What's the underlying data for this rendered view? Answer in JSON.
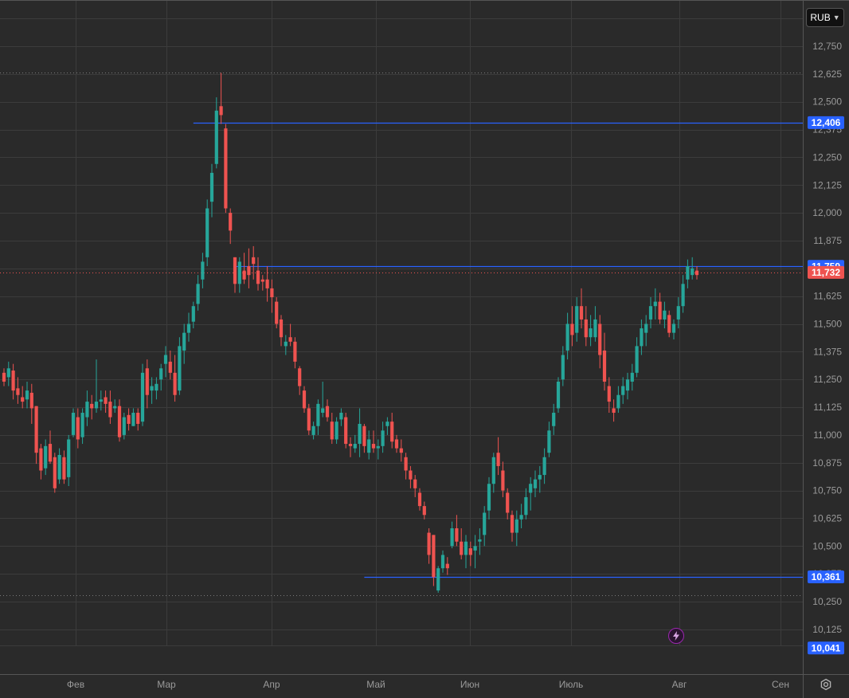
{
  "currency_selector": {
    "label": "RUB",
    "icon": "chevron-down-icon"
  },
  "settings": {
    "icon": "gear-icon"
  },
  "event_marker": {
    "icon": "lightning-icon",
    "color": "#9c27b0"
  },
  "colors": {
    "background": "#2a2a2a",
    "grid": "#3c3c3c",
    "up": "#26a69a",
    "down": "#ef5350",
    "level_line": "#2962ff",
    "level_tag": "#2962ff",
    "last_price_tag": "#ef5350"
  },
  "chart_data": {
    "type": "candlestick",
    "title": "",
    "currency": "RUB",
    "y_axis": {
      "range": [
        10.03,
        12.84
      ],
      "ticks": [
        "12,750",
        "12,625",
        "12,500",
        "12,375",
        "12,250",
        "12,125",
        "12,000",
        "11,875",
        "11,750",
        "11,625",
        "11,500",
        "11,375",
        "11,250",
        "11,125",
        "11,000",
        "10,875",
        "10,750",
        "10,625",
        "10,500",
        "10,375",
        "10,250",
        "10,125"
      ],
      "tick_values": [
        12.75,
        12.625,
        12.5,
        12.375,
        12.25,
        12.125,
        12.0,
        11.875,
        11.75,
        11.625,
        11.5,
        11.375,
        11.25,
        11.125,
        11.0,
        10.875,
        10.75,
        10.625,
        10.5,
        10.375,
        10.25,
        10.125
      ]
    },
    "x_axis": {
      "labels": [
        "Фев",
        "Мар",
        "Апр",
        "Май",
        "Июн",
        "Июль",
        "Авг",
        "Сен"
      ]
    },
    "price_tags": [
      {
        "label": "12,406",
        "value": 12.406,
        "kind": "level",
        "line_from_candle": 41
      },
      {
        "label": "11,759",
        "value": 11.759,
        "kind": "level",
        "line_from_candle": 50
      },
      {
        "label": "11,732",
        "value": 11.732,
        "kind": "last"
      },
      {
        "label": "10,361",
        "value": 10.361,
        "kind": "level",
        "line_from_candle": 78
      },
      {
        "label": "10,041",
        "value": 10.041,
        "kind": "level_tag_only"
      }
    ],
    "dotted_lines": [
      12.63,
      11.732,
      10.28
    ],
    "candles": [
      [
        11.28,
        11.3,
        11.22,
        11.24
      ],
      [
        11.26,
        11.33,
        11.22,
        11.3
      ],
      [
        11.29,
        11.32,
        11.16,
        11.2
      ],
      [
        11.21,
        11.26,
        11.14,
        11.18
      ],
      [
        11.17,
        11.22,
        11.12,
        11.15
      ],
      [
        11.16,
        11.24,
        11.12,
        11.2
      ],
      [
        11.19,
        11.23,
        11.05,
        11.12
      ],
      [
        11.13,
        11.13,
        10.87,
        10.92
      ],
      [
        10.94,
        10.96,
        10.8,
        10.84
      ],
      [
        10.85,
        10.98,
        10.82,
        10.95
      ],
      [
        10.96,
        11.02,
        10.87,
        10.88
      ],
      [
        10.9,
        10.92,
        10.74,
        10.76
      ],
      [
        10.8,
        10.94,
        10.78,
        10.91
      ],
      [
        10.9,
        10.93,
        10.78,
        10.8
      ],
      [
        10.81,
        11.0,
        10.77,
        10.98
      ],
      [
        11.0,
        11.12,
        10.99,
        11.1
      ],
      [
        11.08,
        11.12,
        10.94,
        10.98
      ],
      [
        10.99,
        11.12,
        10.96,
        11.1
      ],
      [
        11.08,
        11.2,
        11.04,
        11.15
      ],
      [
        11.14,
        11.18,
        11.07,
        11.12
      ],
      [
        11.12,
        11.34,
        11.1,
        11.15
      ],
      [
        11.15,
        11.2,
        11.11,
        11.16
      ],
      [
        11.17,
        11.2,
        11.1,
        11.14
      ],
      [
        11.15,
        11.2,
        11.05,
        11.08
      ],
      [
        11.12,
        11.16,
        11.1,
        11.13
      ],
      [
        11.13,
        11.16,
        10.97,
        10.99
      ],
      [
        11.0,
        11.1,
        10.98,
        11.08
      ],
      [
        11.09,
        11.12,
        11.02,
        11.05
      ],
      [
        11.04,
        11.12,
        11.04,
        11.1
      ],
      [
        11.1,
        11.12,
        11.02,
        11.05
      ],
      [
        11.06,
        11.32,
        11.04,
        11.28
      ],
      [
        11.3,
        11.34,
        11.12,
        11.18
      ],
      [
        11.2,
        11.26,
        11.14,
        11.22
      ],
      [
        11.2,
        11.26,
        11.16,
        11.23
      ],
      [
        11.25,
        11.32,
        11.2,
        11.3
      ],
      [
        11.32,
        11.4,
        11.26,
        11.36
      ],
      [
        11.33,
        11.38,
        11.25,
        11.28
      ],
      [
        11.28,
        11.36,
        11.15,
        11.18
      ],
      [
        11.2,
        11.44,
        11.18,
        11.4
      ],
      [
        11.38,
        11.5,
        11.32,
        11.46
      ],
      [
        11.46,
        11.55,
        11.42,
        11.5
      ],
      [
        11.51,
        11.6,
        11.48,
        11.58
      ],
      [
        11.59,
        11.72,
        11.56,
        11.68
      ],
      [
        11.7,
        11.82,
        11.66,
        11.78
      ],
      [
        11.8,
        12.06,
        11.76,
        12.02
      ],
      [
        12.05,
        12.22,
        11.98,
        12.18
      ],
      [
        12.22,
        12.52,
        12.2,
        12.46
      ],
      [
        12.48,
        12.63,
        12.4,
        12.44
      ],
      [
        12.38,
        12.4,
        12.0,
        12.02
      ],
      [
        12.0,
        12.02,
        11.86,
        11.92
      ],
      [
        11.8,
        11.8,
        11.64,
        11.68
      ],
      [
        11.68,
        11.8,
        11.64,
        11.78
      ],
      [
        11.74,
        11.82,
        11.68,
        11.7
      ],
      [
        11.76,
        11.84,
        11.66,
        11.72
      ],
      [
        11.8,
        11.85,
        11.7,
        11.77
      ],
      [
        11.74,
        11.8,
        11.65,
        11.68
      ],
      [
        11.7,
        11.72,
        11.65,
        11.69
      ],
      [
        11.7,
        11.76,
        11.6,
        11.66
      ],
      [
        11.66,
        11.7,
        11.55,
        11.62
      ],
      [
        11.6,
        11.62,
        11.48,
        11.5
      ],
      [
        11.52,
        11.54,
        11.4,
        11.44
      ],
      [
        11.4,
        11.45,
        11.36,
        11.42
      ],
      [
        11.44,
        11.5,
        11.4,
        11.42
      ],
      [
        11.42,
        11.44,
        11.3,
        11.33
      ],
      [
        11.3,
        11.31,
        11.18,
        11.22
      ],
      [
        11.2,
        11.22,
        11.1,
        11.12
      ],
      [
        11.12,
        11.14,
        11.0,
        11.02
      ],
      [
        11.0,
        11.06,
        10.98,
        11.04
      ],
      [
        11.04,
        11.16,
        11.0,
        11.14
      ],
      [
        11.1,
        11.24,
        11.08,
        11.12
      ],
      [
        11.13,
        11.16,
        11.06,
        11.08
      ],
      [
        11.06,
        11.1,
        10.96,
        10.98
      ],
      [
        10.98,
        11.08,
        10.96,
        11.06
      ],
      [
        11.07,
        11.12,
        11.04,
        11.1
      ],
      [
        11.08,
        11.1,
        10.94,
        10.96
      ],
      [
        10.96,
        10.99,
        10.9,
        10.95
      ],
      [
        10.94,
        11.0,
        10.92,
        10.96
      ],
      [
        10.96,
        11.12,
        10.9,
        11.05
      ],
      [
        11.04,
        11.05,
        10.92,
        10.95
      ],
      [
        10.92,
        11.02,
        10.89,
        10.98
      ],
      [
        10.96,
        11.02,
        10.92,
        10.94
      ],
      [
        10.94,
        10.98,
        10.89,
        10.95
      ],
      [
        10.95,
        11.06,
        10.92,
        11.02
      ],
      [
        11.04,
        11.08,
        11.0,
        11.06
      ],
      [
        11.06,
        11.1,
        10.94,
        10.97
      ],
      [
        10.98,
        11.0,
        10.92,
        10.94
      ],
      [
        10.94,
        10.98,
        10.88,
        10.92
      ],
      [
        10.9,
        10.92,
        10.8,
        10.84
      ],
      [
        10.84,
        10.86,
        10.76,
        10.8
      ],
      [
        10.8,
        10.82,
        10.72,
        10.76
      ],
      [
        10.74,
        10.76,
        10.66,
        10.68
      ],
      [
        10.68,
        10.7,
        10.62,
        10.64
      ],
      [
        10.56,
        10.58,
        10.42,
        10.46
      ],
      [
        10.55,
        10.55,
        10.32,
        10.36
      ],
      [
        10.3,
        10.41,
        10.29,
        10.4
      ],
      [
        10.4,
        10.48,
        10.38,
        10.46
      ],
      [
        10.42,
        10.45,
        10.37,
        10.4
      ],
      [
        10.5,
        10.61,
        10.49,
        10.58
      ],
      [
        10.58,
        10.64,
        10.5,
        10.52
      ],
      [
        10.52,
        10.58,
        10.44,
        10.46
      ],
      [
        10.46,
        10.55,
        10.4,
        10.52
      ],
      [
        10.49,
        10.52,
        10.41,
        10.46
      ],
      [
        10.48,
        10.55,
        10.4,
        10.5
      ],
      [
        10.52,
        10.58,
        10.46,
        10.53
      ],
      [
        10.55,
        10.68,
        10.5,
        10.65
      ],
      [
        10.66,
        10.81,
        10.62,
        10.78
      ],
      [
        10.78,
        10.92,
        10.74,
        10.9
      ],
      [
        10.92,
        10.99,
        10.82,
        10.86
      ],
      [
        10.84,
        10.88,
        10.72,
        10.75
      ],
      [
        10.74,
        10.76,
        10.62,
        10.65
      ],
      [
        10.64,
        10.66,
        10.52,
        10.56
      ],
      [
        10.56,
        10.66,
        10.5,
        10.62
      ],
      [
        10.62,
        10.69,
        10.58,
        10.64
      ],
      [
        10.64,
        10.76,
        10.62,
        10.72
      ],
      [
        10.74,
        10.81,
        10.66,
        10.78
      ],
      [
        10.76,
        10.84,
        10.72,
        10.8
      ],
      [
        10.8,
        10.86,
        10.74,
        10.82
      ],
      [
        10.82,
        10.94,
        10.78,
        10.9
      ],
      [
        10.92,
        11.06,
        10.9,
        11.02
      ],
      [
        11.04,
        11.14,
        11.0,
        11.1
      ],
      [
        11.12,
        11.26,
        11.1,
        11.24
      ],
      [
        11.25,
        11.4,
        11.22,
        11.36
      ],
      [
        11.38,
        11.55,
        11.34,
        11.5
      ],
      [
        11.5,
        11.58,
        11.4,
        11.45
      ],
      [
        11.46,
        11.62,
        11.42,
        11.58
      ],
      [
        11.58,
        11.66,
        11.48,
        11.52
      ],
      [
        11.52,
        11.58,
        11.4,
        11.44
      ],
      [
        11.44,
        11.54,
        11.4,
        11.48
      ],
      [
        11.44,
        11.58,
        11.42,
        11.52
      ],
      [
        11.5,
        11.54,
        11.3,
        11.36
      ],
      [
        11.38,
        11.46,
        11.2,
        11.24
      ],
      [
        11.22,
        11.26,
        11.1,
        11.15
      ],
      [
        11.12,
        11.16,
        11.06,
        11.1
      ],
      [
        11.12,
        11.22,
        11.1,
        11.18
      ],
      [
        11.18,
        11.26,
        11.14,
        11.22
      ],
      [
        11.2,
        11.28,
        11.16,
        11.25
      ],
      [
        11.24,
        11.32,
        11.2,
        11.28
      ],
      [
        11.28,
        11.44,
        11.26,
        11.4
      ],
      [
        11.4,
        11.52,
        11.36,
        11.48
      ],
      [
        11.46,
        11.54,
        11.4,
        11.5
      ],
      [
        11.52,
        11.62,
        11.48,
        11.58
      ],
      [
        11.58,
        11.66,
        11.52,
        11.6
      ],
      [
        11.6,
        11.64,
        11.5,
        11.52
      ],
      [
        11.52,
        11.6,
        11.48,
        11.56
      ],
      [
        11.54,
        11.56,
        11.44,
        11.46
      ],
      [
        11.46,
        11.52,
        11.43,
        11.5
      ],
      [
        11.52,
        11.62,
        11.48,
        11.58
      ],
      [
        11.58,
        11.72,
        11.55,
        11.68
      ],
      [
        11.7,
        11.79,
        11.66,
        11.76
      ],
      [
        11.72,
        11.8,
        11.7,
        11.75
      ],
      [
        11.74,
        11.76,
        11.7,
        11.72
      ]
    ]
  }
}
